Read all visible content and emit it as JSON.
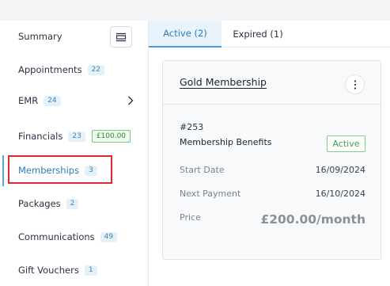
{
  "sidebar": {
    "items": [
      {
        "label": "Summary"
      },
      {
        "label": "Appointments",
        "count": "22"
      },
      {
        "label": "EMR",
        "count": "24"
      },
      {
        "label": "Financials",
        "count": "23",
        "amount": "£100.00"
      },
      {
        "label": "Memberships",
        "count": "3"
      },
      {
        "label": "Packages",
        "count": "2"
      },
      {
        "label": "Communications",
        "count": "49"
      },
      {
        "label": "Gift Vouchers",
        "count": "1"
      }
    ]
  },
  "tabs": [
    {
      "label": "Active (2)"
    },
    {
      "label": "Expired (1)"
    }
  ],
  "card": {
    "title": "Gold Membership",
    "id": "#253",
    "subtitle": "Membership Benefits",
    "status": "Active",
    "start_label": "Start Date",
    "start_value": "16/09/2024",
    "next_label": "Next Payment",
    "next_value": "16/10/2024",
    "price_label": "Price",
    "price_value": "£200.00/month"
  },
  "colors": {
    "accent": "#2e7cc0",
    "highlight": "#e3262d",
    "status_green": "#3ea54f"
  },
  "icons": {
    "collapse": "collapse-icon",
    "chevron": "chevron-right-icon",
    "menu": "kebab-menu-icon"
  }
}
